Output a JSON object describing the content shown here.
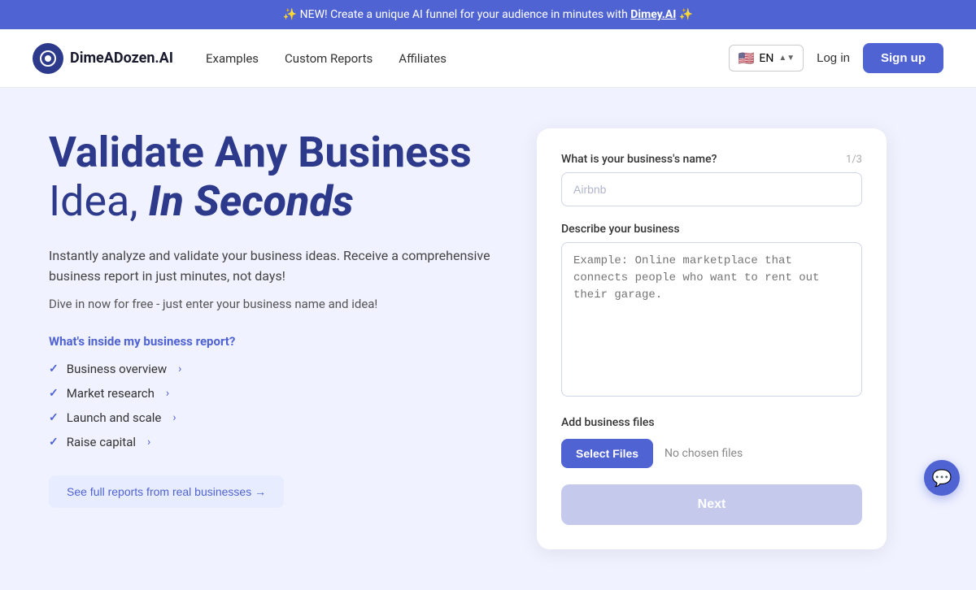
{
  "banner": {
    "text_before": "✨ NEW! Create a unique AI funnel for your audience in minutes with ",
    "link_text": "Dimey.AI",
    "text_after": " ✨"
  },
  "navbar": {
    "logo_text": "DimeADozen.AI",
    "logo_symbol": "⊙",
    "nav_links": [
      {
        "label": "Examples",
        "id": "examples"
      },
      {
        "label": "Custom Reports",
        "id": "custom-reports"
      },
      {
        "label": "Affiliates",
        "id": "affiliates"
      }
    ],
    "lang": "EN",
    "flag": "🇺🇸",
    "login_label": "Log in",
    "signup_label": "Sign up"
  },
  "hero": {
    "headline_line1": "Validate Any Business",
    "headline_line2_normal": "Idea,",
    "headline_line2_bold": "In Seconds",
    "subtext1": "Instantly analyze and validate your business ideas. Receive a comprehensive business report in just minutes, not days!",
    "subtext2": "Dive in now for free - just enter your business name and idea!",
    "features_title": "What's inside my business report?",
    "features": [
      {
        "label": "Business overview"
      },
      {
        "label": "Market research"
      },
      {
        "label": "Launch and scale"
      },
      {
        "label": "Raise capital"
      }
    ],
    "see_reports_label": "See full reports from real businesses →"
  },
  "form": {
    "business_name_label": "What is your business's name?",
    "step_indicator": "1/3",
    "business_name_placeholder": "Airbnb",
    "describe_label": "Describe your business",
    "describe_placeholder": "Example: Online marketplace that connects people who want to rent out their garage.",
    "add_files_label": "Add business files",
    "select_files_label": "Select Files",
    "no_files_text": "No chosen files",
    "next_label": "Next"
  },
  "chat_bubble": {
    "icon": "💬"
  }
}
